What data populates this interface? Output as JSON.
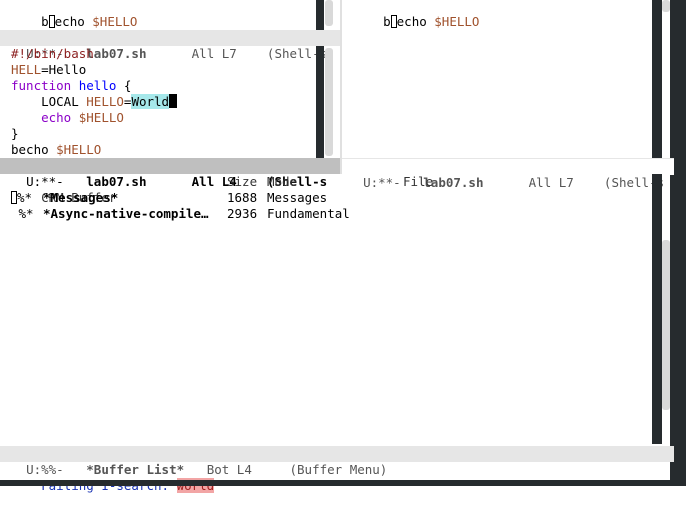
{
  "top_left_window": {
    "line": {
      "prefix": "b",
      "rest": "echo ",
      "var": "$HELLO"
    },
    "modeline": {
      "status": "U:**-",
      "buffer": "lab07.sh",
      "position": "All L7",
      "mode": "(Shell-s"
    }
  },
  "top_right_window": {
    "line": {
      "prefix": "b",
      "rest": "echo ",
      "var": "$HELLO"
    }
  },
  "middle_left_window": {
    "lines": {
      "shebang": "#!/bin/bash",
      "assign_var": "HELL",
      "assign_val": "=Hello",
      "function_kw": "function",
      "function_name": "hello",
      "function_open": " {",
      "local_indent": "    LOCAL ",
      "local_var": "HELLO",
      "local_eq": "=",
      "local_match": "World",
      "echo_indent": "    ",
      "echo_kw": "echo",
      "echo_var": " $HELLO",
      "close_brace": "}",
      "last_text": "becho ",
      "last_var": "$HELLO"
    },
    "modeline": {
      "status": "U:**-",
      "buffer": "lab07.sh",
      "position": "All L4",
      "mode": "(Shell-s"
    }
  },
  "right_modeline": {
    "status": "U:**-",
    "buffer": "lab07.sh",
    "position": "All L7",
    "mode": "(Shell-s"
  },
  "buffer_list": {
    "headers": {
      "crm": "CRM",
      "buffer": "Buffer",
      "size": "Size",
      "mode": "Mode",
      "file": "File"
    },
    "rows": [
      {
        "crm": "%*",
        "name": "*Messages*",
        "size": "1688",
        "mode": "Messages"
      },
      {
        "crm": " %*",
        "name": "*Async-native-compile…",
        "size": "2936",
        "mode": "Fundamental"
      }
    ],
    "modeline": {
      "status": "U:%%-",
      "buffer": "*Buffer List*",
      "position": "Bot L4",
      "mode": "(Buffer Menu)"
    }
  },
  "minibuffer": {
    "prompt": "Failing I-search: ",
    "query": "world"
  }
}
